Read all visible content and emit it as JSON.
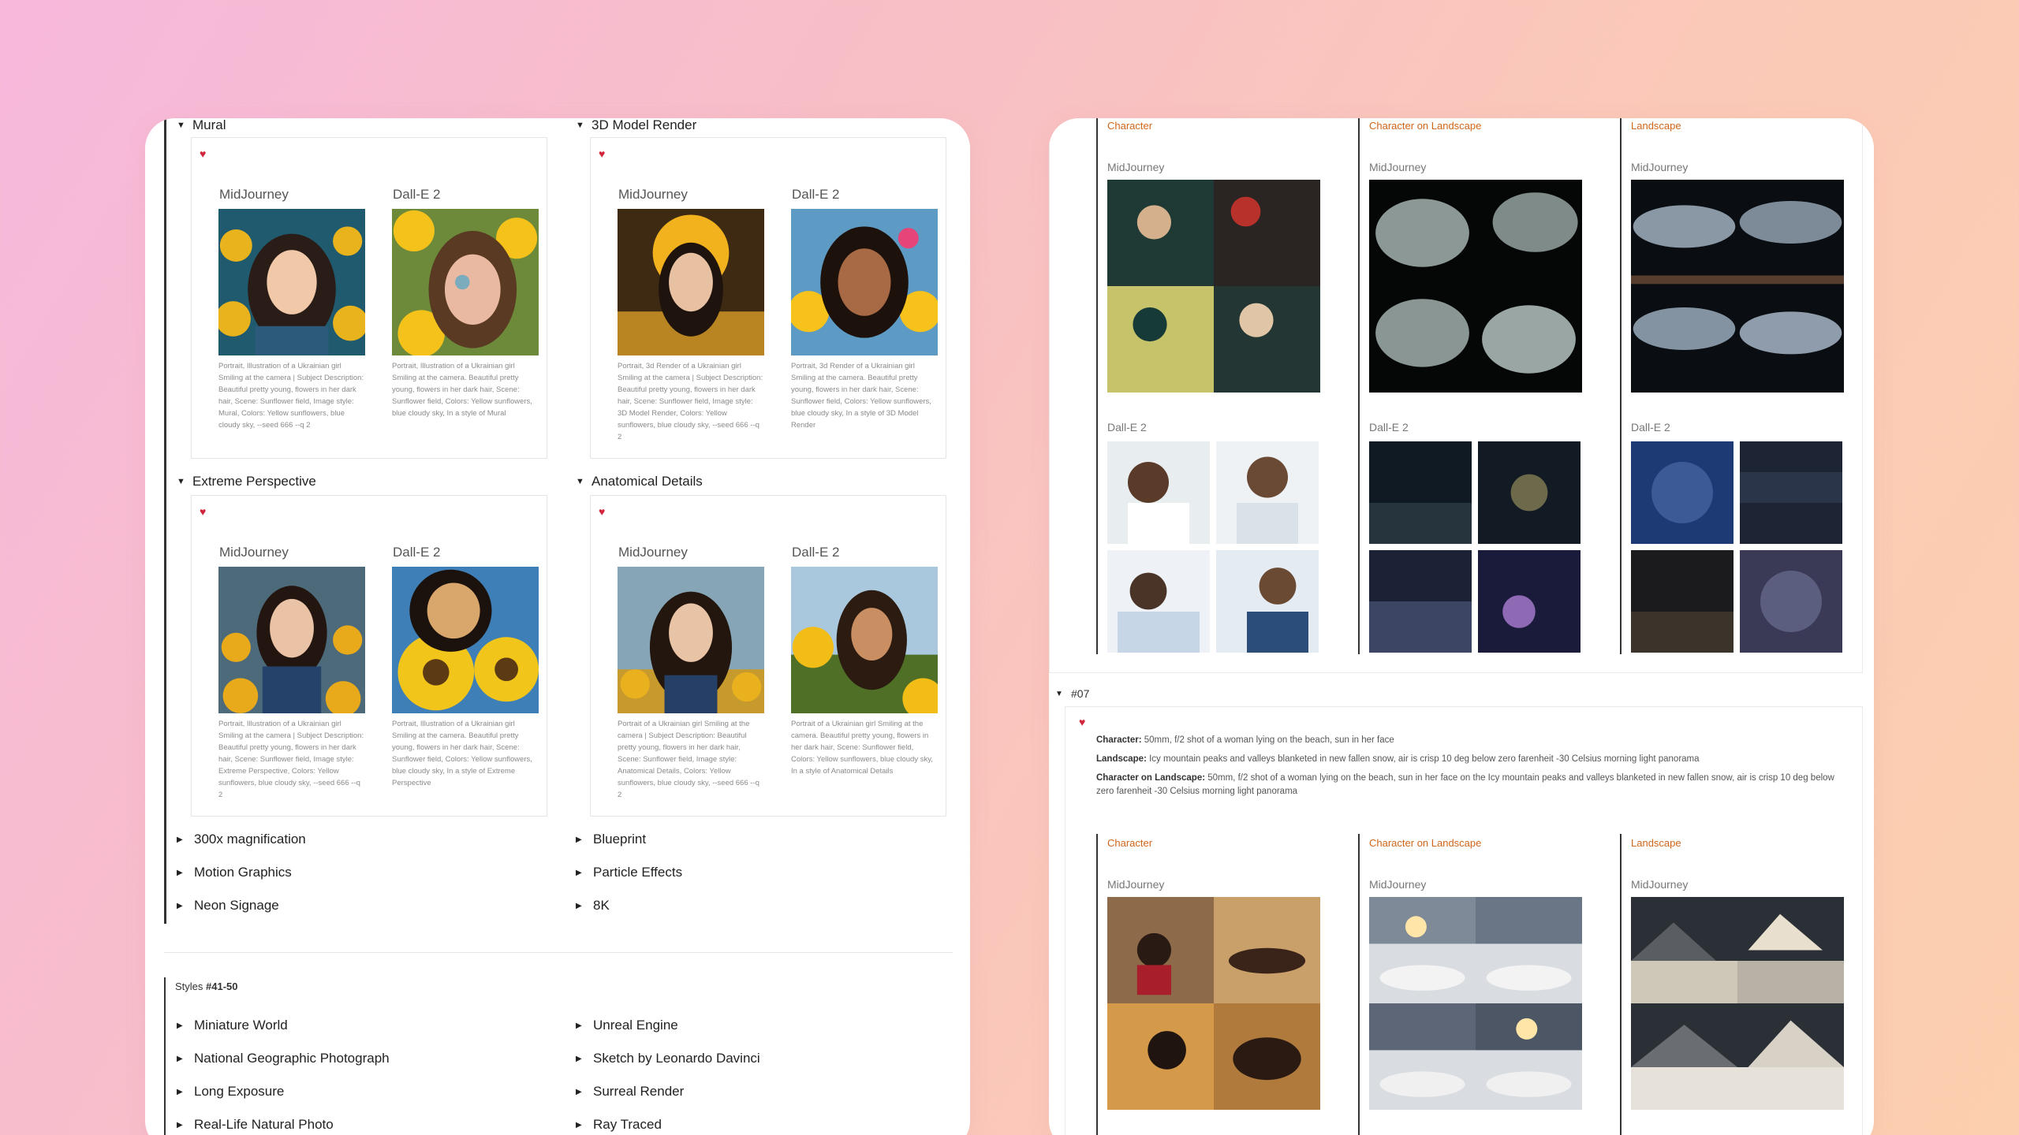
{
  "left": {
    "sections": [
      {
        "title": "Mural",
        "mj": "MidJourney",
        "de": "Dall-E 2",
        "cap_mj": "Portrait, Illustration of a Ukrainian girl Smiling at the camera | Subject Description: Beautiful pretty young, flowers in her dark hair, Scene: Sunflower field, Image style: Mural, Colors: Yellow sunflowers, blue cloudy sky, --seed 666 --q 2",
        "cap_de": "Portrait, Illustration of a Ukrainian girl Smiling at the camera. Beautiful pretty young, flowers in her dark hair, Scene: Sunflower field, Colors: Yellow sunflowers, blue cloudy sky, In a style of Mural"
      },
      {
        "title": "3D Model Render",
        "mj": "MidJourney",
        "de": "Dall-E 2",
        "cap_mj": "Portrait, 3d Render of a Ukrainian girl Smiling at the camera | Subject Description: Beautiful pretty young, flowers in her dark hair, Scene: Sunflower field, Image style: 3D Model Render, Colors: Yellow sunflowers, blue cloudy sky, --seed 666 --q 2",
        "cap_de": "Portrait, 3d Render of a Ukrainian girl Smiling at the camera. Beautiful pretty young, flowers in her dark hair, Scene: Sunflower field, Colors: Yellow sunflowers, blue cloudy sky, In a style of 3D Model Render"
      },
      {
        "title": "Extreme Perspective",
        "mj": "MidJourney",
        "de": "Dall-E 2",
        "cap_mj": "Portrait, Illustration of a Ukrainian girl Smiling at the camera | Subject Description: Beautiful pretty young, flowers in her dark hair, Scene: Sunflower field, Image style: Extreme Perspective, Colors: Yellow sunflowers, blue cloudy sky, --seed 666 --q 2",
        "cap_de": "Portrait, Illustration of a Ukrainian girl Smiling at the camera. Beautiful pretty young, flowers in her dark hair, Scene: Sunflower field, Colors: Yellow sunflowers, blue cloudy sky, In a style of Extreme Perspective"
      },
      {
        "title": "Anatomical Details",
        "mj": "MidJourney",
        "de": "Dall-E 2",
        "cap_mj": "Portrait of a Ukrainian girl Smiling at the camera | Subject Description: Beautiful pretty young, flowers in her dark hair, Scene: Sunflower field, Image style: Anatomical Details, Colors: Yellow sunflowers, blue cloudy sky, --seed 666 --q 2",
        "cap_de": "Portrait of a Ukrainian girl Smiling at the camera. Beautiful pretty young, flowers in her dark hair, Scene: Sunflower field, Colors: Yellow sunflowers, blue cloudy sky, In a style of Anatomical Details"
      }
    ],
    "collapsed_left": [
      "300x magnification",
      "Motion Graphics",
      "Neon Signage"
    ],
    "collapsed_right": [
      "Blueprint",
      "Particle Effects",
      "8K"
    ],
    "styles_group": {
      "prefix": "Styles ",
      "range": "#41-50"
    },
    "group_left": [
      "Miniature World",
      "National Geographic Photograph",
      "Long Exposure",
      "Real-Life Natural Photo"
    ],
    "group_right": [
      "Unreal Engine",
      "Sketch by Leonardo Davinci",
      "Surreal Render",
      "Ray Traced"
    ]
  },
  "right": {
    "columns": [
      "Character",
      "Character on Landscape",
      "Landscape"
    ],
    "mj": "MidJourney",
    "de": "Dall-E 2",
    "section07": {
      "title": "#07",
      "lines": [
        {
          "key": "Character:",
          "text": " 50mm, f/2 shot of a woman lying on the beach, sun in her face"
        },
        {
          "key": "Landscape:",
          "text": " Icy mountain peaks and valleys blanketed in new fallen snow, air is crisp 10 deg below zero farenheit -30 Celsius morning light panorama"
        },
        {
          "key": "Character on Landscape:",
          "text": " 50mm, f/2 shot of a woman lying on the beach, sun in her face on the Icy mountain peaks and valleys blanketed in new fallen snow, air is crisp 10 deg below zero farenheit -30 Celsius morning light panorama"
        }
      ]
    }
  },
  "colors": {
    "accent_orange": "#d0661a",
    "heart_red": "#d2243b"
  },
  "icons": {
    "heart": "heart-icon",
    "toggle": "triangle-toggle-icon"
  }
}
